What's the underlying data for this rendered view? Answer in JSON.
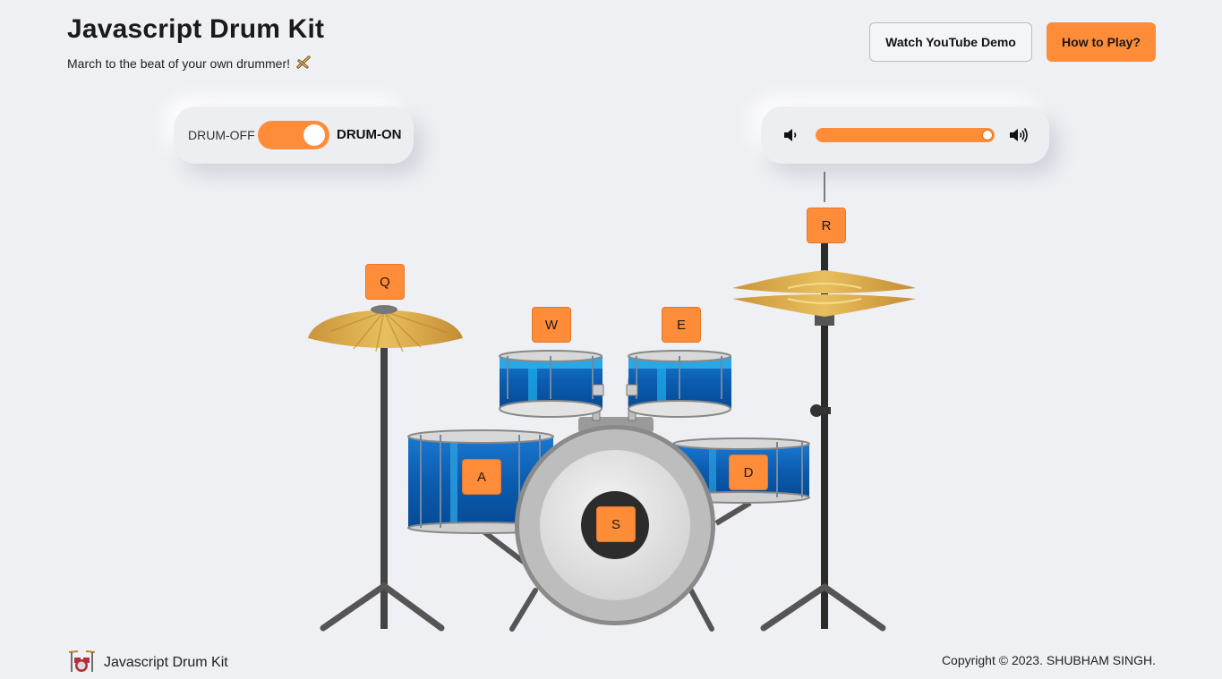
{
  "header": {
    "title": "Javascript Drum Kit",
    "subtitle": "March to the beat of your own drummer!",
    "subtitle_icon": "drumsticks-icon"
  },
  "nav": {
    "youtube_label": "Watch YouTube Demo",
    "how_to_label": "How to Play?"
  },
  "power": {
    "off_label": "DRUM-OFF",
    "on_label": "DRUM-ON",
    "state": "on"
  },
  "volume": {
    "level": 1.0,
    "low_icon": "volume-low-icon",
    "high_icon": "volume-high-icon"
  },
  "drums": [
    {
      "key": "Q",
      "name": "crash-cymbal"
    },
    {
      "key": "W",
      "name": "tom-high"
    },
    {
      "key": "E",
      "name": "tom-mid"
    },
    {
      "key": "R",
      "name": "hi-hat"
    },
    {
      "key": "A",
      "name": "floor-tom"
    },
    {
      "key": "S",
      "name": "bass-drum"
    },
    {
      "key": "D",
      "name": "tom-low"
    }
  ],
  "footer": {
    "brand": "Javascript Drum Kit",
    "copyright": "Copyright © 2023. SHUBHAM SINGH."
  },
  "colors": {
    "accent": "#ff8c38",
    "background": "#eff0f4",
    "drum_blue": "#0a5fb4",
    "cymbal_gold": "#d9a84a"
  }
}
